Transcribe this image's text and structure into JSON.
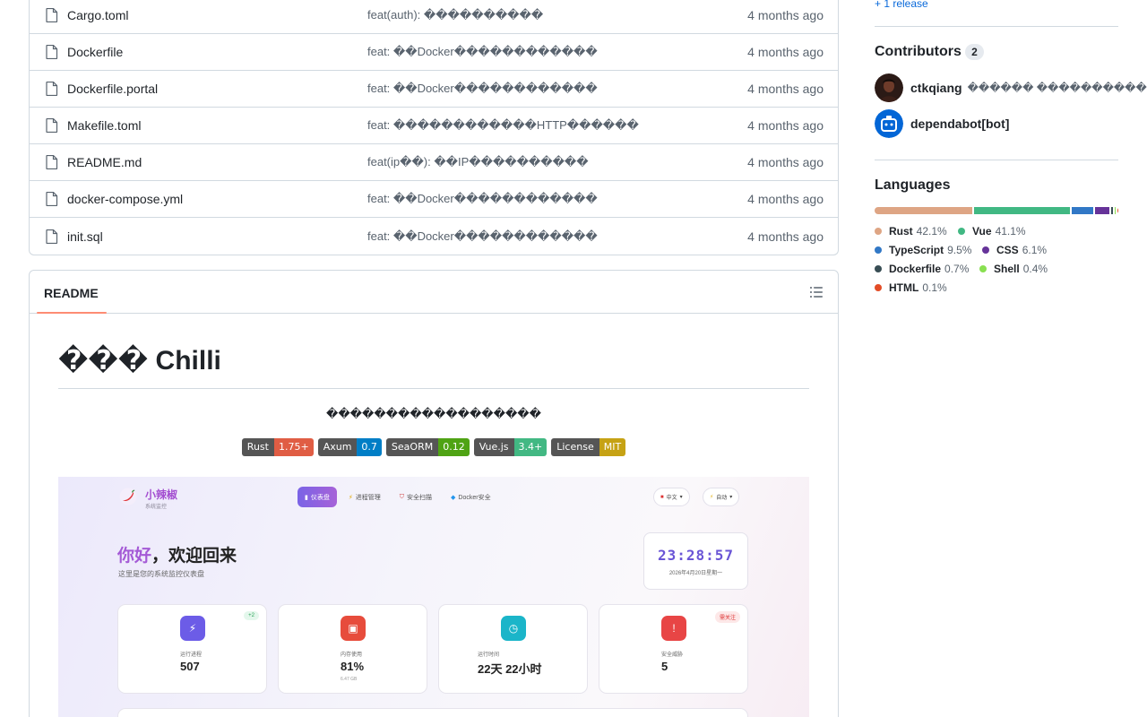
{
  "files": [
    {
      "name": "Cargo.toml",
      "message": "feat(auth): ����������",
      "date": "4 months ago"
    },
    {
      "name": "Dockerfile",
      "message": "feat: ��Docker������������",
      "date": "4 months ago"
    },
    {
      "name": "Dockerfile.portal",
      "message": "feat: ��Docker������������",
      "date": "4 months ago"
    },
    {
      "name": "Makefile.toml",
      "message": "feat: ������������HTTP������",
      "date": "4 months ago"
    },
    {
      "name": "README.md",
      "message": "feat(ip��): ��IP����������",
      "date": "4 months ago"
    },
    {
      "name": "docker-compose.yml",
      "message": "feat: ��Docker������������",
      "date": "4 months ago"
    },
    {
      "name": "init.sql",
      "message": "feat: ��Docker������������",
      "date": "4 months ago"
    }
  ],
  "readme": {
    "tab_label": "README",
    "outline_icon": "list-unordered-icon",
    "title": "��� Chilli",
    "description": "������������������",
    "badges": [
      {
        "label": "Rust",
        "value": "1.75+",
        "color": "#e05d44"
      },
      {
        "label": "Axum",
        "value": "0.7",
        "color": "#007ec6"
      },
      {
        "label": "SeaORM",
        "value": "0.12",
        "color": "#4c1"
      },
      {
        "label": "Vue.js",
        "value": "3.4+",
        "color": "#42b883"
      },
      {
        "label": "License",
        "value": "MIT",
        "color": "#dfb317"
      }
    ]
  },
  "screenshot": {
    "brand": "小辣椒",
    "brand_sub": "系统监控",
    "nav": [
      "仪表盘",
      "进程管理",
      "安全扫描",
      "Docker安全"
    ],
    "lang_pill": "中文",
    "theme_pill": "自动",
    "greeting_highlight": "你好",
    "greeting_rest": "，欢迎回来",
    "greeting_sub": "这里是您的系统监控仪表盘",
    "clock_time": "23:28:57",
    "clock_date": "2026年4月20日星期一",
    "cards": [
      {
        "label": "运行进程",
        "value": "507",
        "tag": "+2",
        "sub": "",
        "color": "#6c5ce7",
        "glyph": "⚡"
      },
      {
        "label": "内存使用",
        "value": "81%",
        "tag": "",
        "sub": "6.47 GB",
        "color": "#e74c3c",
        "glyph": "▣"
      },
      {
        "label": "运行时间",
        "value": "22天 22小时",
        "tag": "",
        "sub": "",
        "color": "#1bb5c9",
        "glyph": "◷"
      },
      {
        "label": "安全威胁",
        "value": "5",
        "tag": "需关注",
        "sub": "",
        "color": "#e84545",
        "glyph": "!"
      }
    ]
  },
  "sidebar": {
    "release_link": "+ 1 release",
    "contributors_title": "Contributors",
    "contributors_count": "2",
    "contributors": [
      {
        "login": "ctkqiang",
        "name": "������ ����������"
      },
      {
        "login": "dependabot[bot]",
        "name": ""
      }
    ],
    "languages_title": "Languages",
    "languages": [
      {
        "name": "Rust",
        "pct": "42.1%",
        "share": 42.1,
        "color": "#dea584"
      },
      {
        "name": "Vue",
        "pct": "41.1%",
        "share": 41.1,
        "color": "#41b883"
      },
      {
        "name": "TypeScript",
        "pct": "9.5%",
        "share": 9.5,
        "color": "#3178c6"
      },
      {
        "name": "CSS",
        "pct": "6.1%",
        "share": 6.1,
        "color": "#663399"
      },
      {
        "name": "Dockerfile",
        "pct": "0.7%",
        "share": 0.7,
        "color": "#384d54"
      },
      {
        "name": "Shell",
        "pct": "0.4%",
        "share": 0.4,
        "color": "#89e051"
      },
      {
        "name": "HTML",
        "pct": "0.1%",
        "share": 0.1,
        "color": "#e34c26"
      }
    ]
  }
}
